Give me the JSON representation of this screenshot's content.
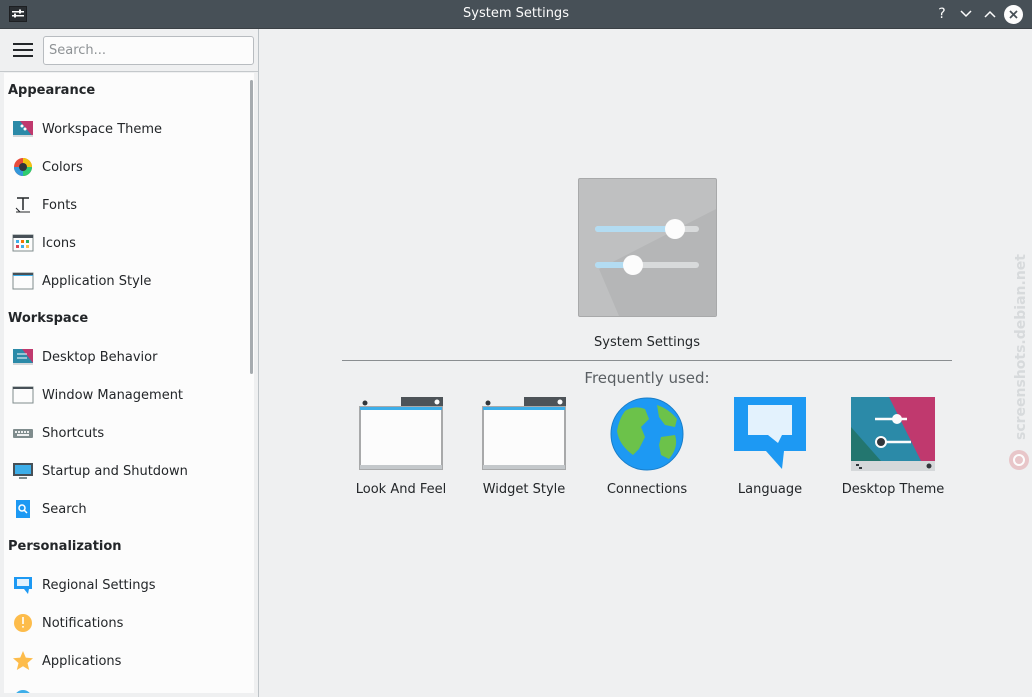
{
  "window": {
    "title": "System Settings"
  },
  "titlebar": {
    "help": "?",
    "minimize": "⌄",
    "maximize": "⌃",
    "close": "✕"
  },
  "sidebar": {
    "search_placeholder": "Search...",
    "categories": [
      {
        "label": "Appearance",
        "items": [
          "Workspace Theme",
          "Colors",
          "Fonts",
          "Icons",
          "Application Style"
        ]
      },
      {
        "label": "Workspace",
        "items": [
          "Desktop Behavior",
          "Window Management",
          "Shortcuts",
          "Startup and Shutdown",
          "Search"
        ]
      },
      {
        "label": "Personalization",
        "items": [
          "Regional Settings",
          "Notifications",
          "Applications"
        ]
      }
    ]
  },
  "main": {
    "hero_label": "System Settings",
    "frequently_used_label": "Frequently used:",
    "tiles": [
      "Look And Feel",
      "Widget Style",
      "Connections",
      "Language",
      "Desktop Theme"
    ]
  },
  "watermark": {
    "text": "screenshots.debian.net"
  },
  "colors": {
    "titlebar": "#475057",
    "accent": "#3daee9",
    "sidebar_bg": "#fcfcfc",
    "window_bg": "#eff0f1"
  }
}
